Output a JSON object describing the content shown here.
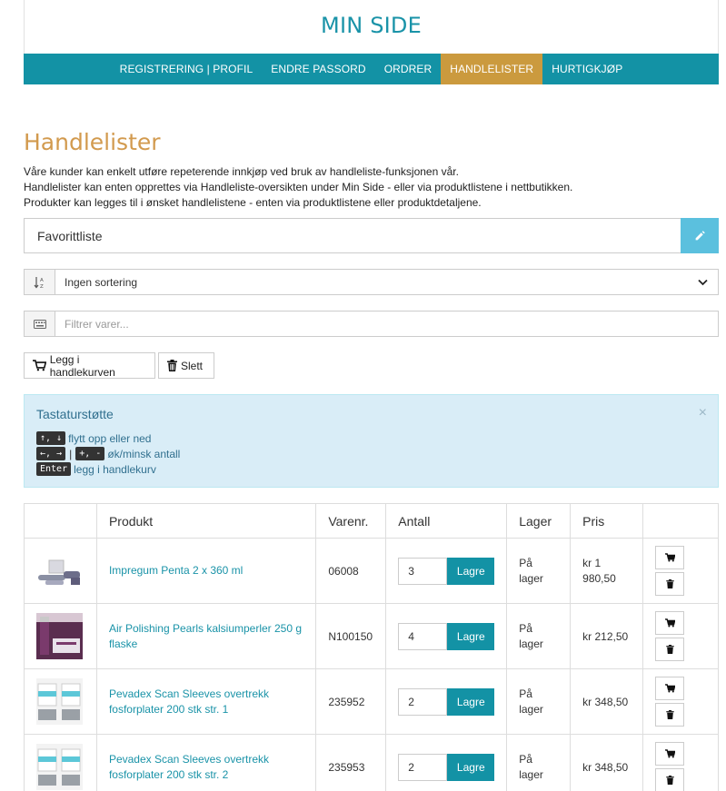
{
  "header": {
    "title": "MIN SIDE"
  },
  "nav": {
    "items": [
      {
        "label": "REGISTRERING | PROFIL"
      },
      {
        "label": "ENDRE PASSORD"
      },
      {
        "label": "ORDRER"
      },
      {
        "label": "HANDLELISTER"
      },
      {
        "label": "HURTIGKJØP"
      }
    ],
    "active_color": "#cb9a3e",
    "bar_color": "#1392a5"
  },
  "page": {
    "heading": "Handlelister",
    "intro": [
      "Våre kunder kan enkelt utføre repeterende innkjøp ved bruk av handleliste-funksjonen vår.",
      "Handlelister kan enten opprettes via Handleliste-oversikten under Min Side - eller via produktlistene i nettbutikken.",
      "Produkter kan legges til i ønsket handlelistene - enten via produktlistene eller produktdetaljene."
    ]
  },
  "list": {
    "name": "Favorittliste",
    "edit_icon": "pencil-icon"
  },
  "sort": {
    "value": "Ingen sortering",
    "icon": "sort-alpha-icon"
  },
  "filter": {
    "placeholder": "Filtrer varer...",
    "icon": "keyboard-icon"
  },
  "actions": {
    "add_to_cart": "Legg i handlekurven",
    "delete": "Slett"
  },
  "keyboard_help": {
    "title": "Tastaturstøtte",
    "close": "×",
    "lines": [
      {
        "keys": [
          "↑, ↓"
        ],
        "text": "flytt opp eller ned"
      },
      {
        "keys": [
          "←, →",
          "+, -"
        ],
        "separator": "|",
        "text": "øk/minsk antall"
      },
      {
        "keys": [
          "Enter"
        ],
        "text": "legg i handlekurv"
      }
    ]
  },
  "table": {
    "headers": [
      "",
      "Produkt",
      "Varenr.",
      "Antall",
      "Lager",
      "Pris",
      ""
    ],
    "save_label": "Lagre",
    "rows": [
      {
        "name": "Impregum Penta 2 x 360 ml",
        "sku": "06008",
        "qty": "3",
        "stock": "På lager",
        "price": "kr 1 980,50"
      },
      {
        "name": "Air Polishing Pearls kalsiumperler 250 g flaske",
        "sku": "N100150",
        "qty": "4",
        "stock": "På lager",
        "price": "kr 212,50"
      },
      {
        "name": "Pevadex Scan Sleeves overtrekk fosforplater 200 stk str. 1",
        "sku": "235952",
        "qty": "2",
        "stock": "På lager",
        "price": "kr 348,50"
      },
      {
        "name": "Pevadex Scan Sleeves overtrekk fosforplater 200 stk str. 2",
        "sku": "235953",
        "qty": "2",
        "stock": "På lager",
        "price": "kr 348,50"
      }
    ]
  }
}
